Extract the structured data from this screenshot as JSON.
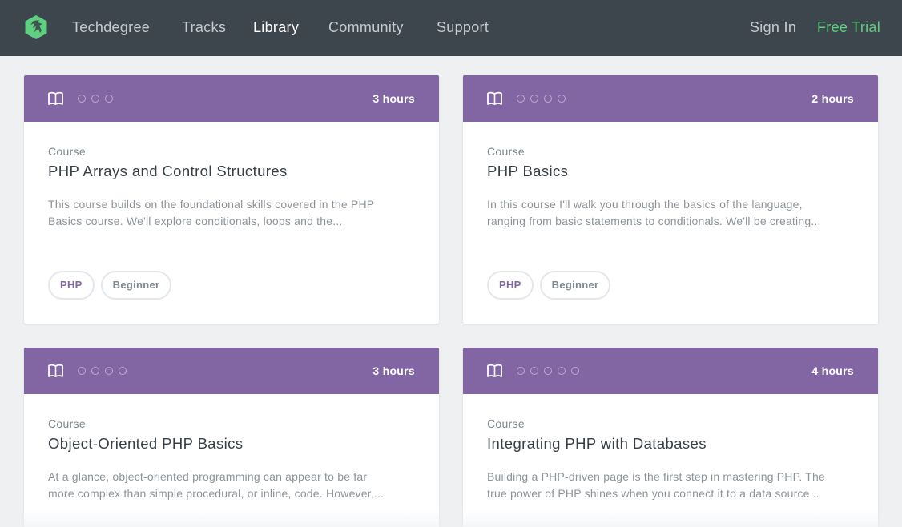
{
  "nav": {
    "logo_icon": "treehouse-logo-icon",
    "links": [
      "Techdegree",
      "Tracks",
      "Library",
      "Community",
      "Support"
    ],
    "active": "Library",
    "sign_in": "Sign In",
    "free_trial": "Free Trial"
  },
  "colors": {
    "navbar": "#3e464d",
    "card_header": "#8266a4",
    "accent_green": "#5fcf80",
    "page_bg": "#eef0f2"
  },
  "cards": [
    {
      "icon": "book-icon",
      "dots": 3,
      "duration": "3 hours",
      "kind": "Course",
      "title": "PHP Arrays and Control Structures",
      "description_lines": [
        "This course builds on the foundational skills covered in the PHP",
        "Basics course. We'll explore conditionals, loops and the..."
      ],
      "tags": [
        "PHP",
        "Beginner"
      ]
    },
    {
      "icon": "book-icon",
      "dots": 4,
      "duration": "2 hours",
      "kind": "Course",
      "title": "PHP Basics",
      "description_lines": [
        "In this course I'll walk you through the basics of the language,",
        "ranging from basic statements to conditionals. We'll be creating..."
      ],
      "tags": [
        "PHP",
        "Beginner"
      ]
    },
    {
      "icon": "book-icon",
      "dots": 4,
      "duration": "3 hours",
      "kind": "Course",
      "title": "Object-Oriented PHP Basics",
      "description_lines": [
        "At a glance, object-oriented programming can appear to be far",
        "more complex than simple procedural, or inline, code. However,..."
      ],
      "tags": []
    },
    {
      "icon": "book-icon",
      "dots": 5,
      "duration": "4 hours",
      "kind": "Course",
      "title": "Integrating PHP with Databases",
      "description_lines": [
        "Building a PHP-driven page is the first step in mastering PHP. The",
        "true power of PHP shines when you connect it to a data source..."
      ],
      "tags": []
    }
  ]
}
